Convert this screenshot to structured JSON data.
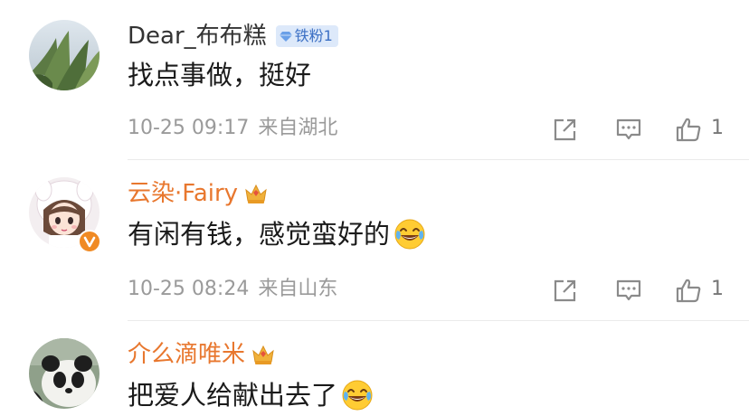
{
  "comments": [
    {
      "avatar": "cornfield-sky-avatar",
      "name": "Dear_布布糕",
      "badge": "铁粉1",
      "text": "找点事做，挺好",
      "time": "10-25 09:17",
      "location": "来自湖北",
      "likes": "1",
      "name_color": "#333333"
    },
    {
      "avatar": "cartoon-girl-avatar",
      "name": "云染·Fairy",
      "badge_icon": "crown-icon",
      "verified": true,
      "text": "有闲有钱，感觉蛮好的",
      "emoji": "laughing-tears-emoji",
      "time": "10-25 08:24",
      "location": "来自山东",
      "likes": "1",
      "name_color": "#e8772e"
    },
    {
      "avatar": "panda-avatar",
      "name": "介么滴唯米",
      "badge_icon": "crown-icon",
      "text": "把爱人给献出去了",
      "emoji": "laughing-tears-emoji",
      "name_color": "#e8772e"
    }
  ],
  "colors": {
    "meta_gray": "#9a9a9a",
    "orange_name": "#e8772e",
    "fans_badge_bg": "#dde9fa",
    "fans_badge_text": "#3b6fc4"
  }
}
